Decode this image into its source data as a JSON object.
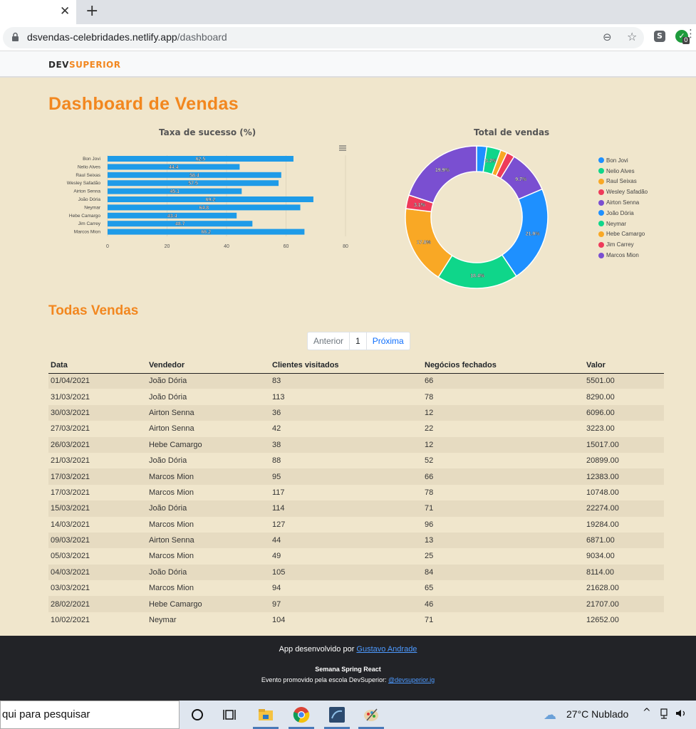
{
  "browser": {
    "url_domain": "dsvendas-celebridades.netlify.app",
    "url_path": "/dashboard",
    "ext_badge": "0"
  },
  "navbar": {
    "logo_dev": "DEV",
    "logo_superior": "SUPERIOR"
  },
  "page_title": "Dashboard de Vendas",
  "bar_chart_title": "Taxa de sucesso (%)",
  "donut_chart_title": "Total de vendas",
  "chart_data": [
    {
      "type": "bar",
      "orientation": "horizontal",
      "title": "Taxa de sucesso (%)",
      "categories": [
        "Bon Jovi",
        "Nelio Alves",
        "Raul Seixas",
        "Wesley Safadão",
        "Airton Senna",
        "João Dória",
        "Neymar",
        "Hebe Camargo",
        "Jim Carrey",
        "Marcos Mion"
      ],
      "values": [
        62.5,
        44.4,
        58.4,
        57.5,
        45.1,
        69.2,
        64.8,
        43.4,
        48.7,
        66.2
      ],
      "xlim": [
        0,
        80
      ],
      "xticks": [
        0,
        20,
        40,
        60,
        80
      ],
      "color": "#1e9be8"
    },
    {
      "type": "pie",
      "donut": true,
      "title": "Total de vendas",
      "labels": [
        "Bon Jovi",
        "Nelio Alves",
        "Raul Seixas",
        "Wesley Safadão",
        "Airton Senna",
        "João Dória",
        "Neymar",
        "Hebe Camargo",
        "Jim Carrey",
        "Marcos Mion"
      ],
      "values": [
        2.3,
        3.2,
        1.5,
        1.8,
        9.7,
        21.9,
        18.4,
        17.8,
        3.1,
        19.9
      ],
      "value_labels": [
        "",
        "3.2%",
        "",
        "",
        "9.7%",
        "21.9%",
        "18.4%",
        "17.8%",
        "3.1%",
        "19.9%"
      ],
      "colors": [
        "#1e90ff",
        "#0fd68a",
        "#f9a825",
        "#ee3b5a",
        "#7a4fd1",
        "#1e90ff",
        "#0fd68a",
        "#f9a825",
        "#ee3b5a",
        "#7a4fd1"
      ],
      "legend_position": "right"
    }
  ],
  "sales_section_title": "Todas Vendas",
  "pagination": {
    "prev": "Anterior",
    "page": "1",
    "next": "Próxima"
  },
  "table": {
    "headers": [
      "Data",
      "Vendedor",
      "Clientes visitados",
      "Negócios fechados",
      "Valor"
    ],
    "rows": [
      [
        "01/04/2021",
        "João Dória",
        "83",
        "66",
        "5501.00"
      ],
      [
        "31/03/2021",
        "João Dória",
        "113",
        "78",
        "8290.00"
      ],
      [
        "30/03/2021",
        "Airton Senna",
        "36",
        "12",
        "6096.00"
      ],
      [
        "27/03/2021",
        "Airton Senna",
        "42",
        "22",
        "3223.00"
      ],
      [
        "26/03/2021",
        "Hebe Camargo",
        "38",
        "12",
        "15017.00"
      ],
      [
        "21/03/2021",
        "João Dória",
        "88",
        "52",
        "20899.00"
      ],
      [
        "17/03/2021",
        "Marcos Mion",
        "95",
        "66",
        "12383.00"
      ],
      [
        "17/03/2021",
        "Marcos Mion",
        "117",
        "78",
        "10748.00"
      ],
      [
        "15/03/2021",
        "João Dória",
        "114",
        "71",
        "22274.00"
      ],
      [
        "14/03/2021",
        "Marcos Mion",
        "127",
        "96",
        "19284.00"
      ],
      [
        "09/03/2021",
        "Airton Senna",
        "44",
        "13",
        "6871.00"
      ],
      [
        "05/03/2021",
        "Marcos Mion",
        "49",
        "25",
        "9034.00"
      ],
      [
        "04/03/2021",
        "João Dória",
        "105",
        "84",
        "8114.00"
      ],
      [
        "03/03/2021",
        "Marcos Mion",
        "94",
        "65",
        "21628.00"
      ],
      [
        "28/02/2021",
        "Hebe Camargo",
        "97",
        "46",
        "21707.00"
      ],
      [
        "10/02/2021",
        "Neymar",
        "104",
        "71",
        "12652.00"
      ]
    ]
  },
  "footer": {
    "dev_text": "App desenvolvido por ",
    "dev_link": "Gustavo Andrade",
    "event": "Semana Spring React",
    "promo_text": "Evento promovido pela escola DevSuperior: ",
    "promo_link": "@devsuperior.ig"
  },
  "taskbar": {
    "search_text": "qui para pesquisar",
    "weather": "27°C  Nublado"
  }
}
